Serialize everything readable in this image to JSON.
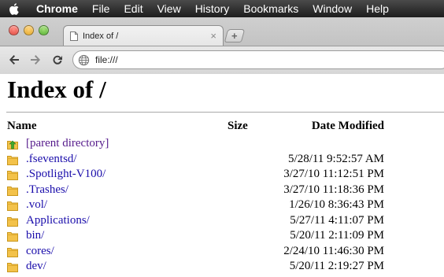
{
  "menubar": {
    "app_name": "Chrome",
    "items": [
      "File",
      "Edit",
      "View",
      "History",
      "Bookmarks",
      "Window",
      "Help"
    ]
  },
  "tab": {
    "title": "Index of /",
    "close_glyph": "×"
  },
  "newtab_glyph": "+",
  "omnibox": {
    "url": "file:///"
  },
  "page": {
    "heading": "Index of /",
    "columns": {
      "name": "Name",
      "size": "Size",
      "date": "Date Modified"
    },
    "parent": {
      "label": "[parent directory]",
      "icon": "up-arrow-folder-icon"
    },
    "entries": [
      {
        "name": ".fseventsd/",
        "size": "",
        "date": "5/28/11 9:52:57 AM"
      },
      {
        "name": ".Spotlight-V100/",
        "size": "",
        "date": "3/27/10 11:12:51 PM"
      },
      {
        "name": ".Trashes/",
        "size": "",
        "date": "3/27/10 11:18:36 PM"
      },
      {
        "name": ".vol/",
        "size": "",
        "date": "1/26/10 8:36:43 PM"
      },
      {
        "name": "Applications/",
        "size": "",
        "date": "5/27/11 4:11:07 PM"
      },
      {
        "name": "bin/",
        "size": "",
        "date": "5/20/11 2:11:09 PM"
      },
      {
        "name": "cores/",
        "size": "",
        "date": "2/24/10 11:46:30 PM"
      },
      {
        "name": "dev/",
        "size": "",
        "date": "5/20/11 2:19:27 PM"
      }
    ]
  },
  "colors": {
    "link": "#1a0dab",
    "visited_link": "#551a8b",
    "folder": "#f3c24a",
    "menubar": "#2a2a2a"
  }
}
